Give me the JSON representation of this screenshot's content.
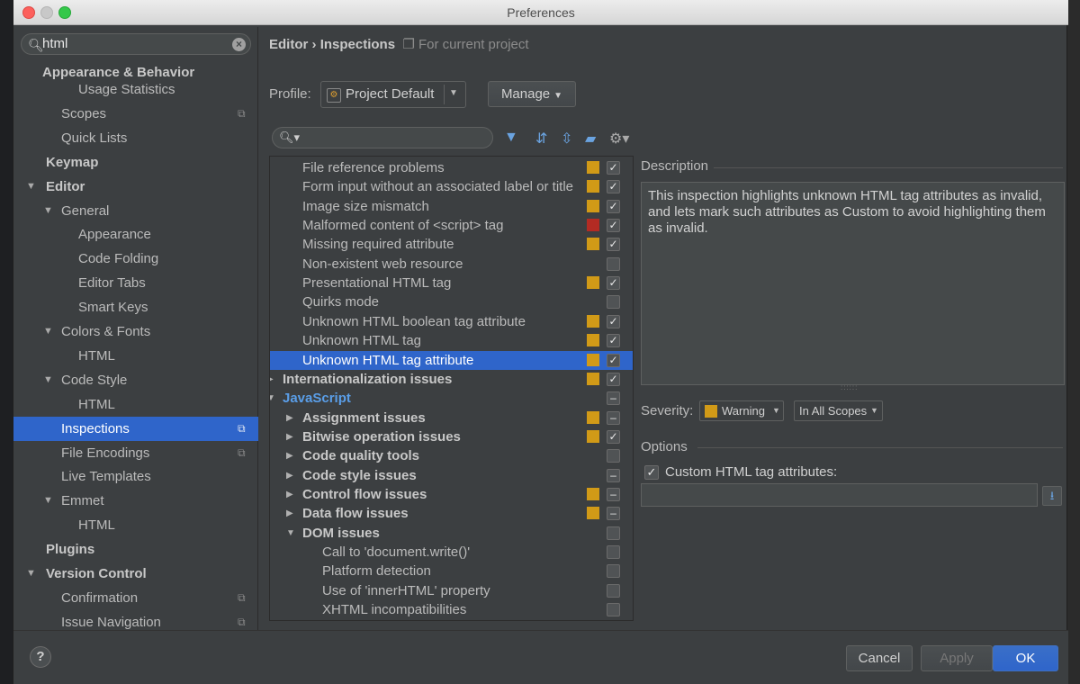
{
  "window": {
    "title": "Preferences"
  },
  "sidebar": {
    "search_value": "html",
    "items": [
      {
        "label": "Appearance & Behavior",
        "level": 0,
        "bold": true
      },
      {
        "label": "Usage Statistics",
        "level": 2
      },
      {
        "label": "Scopes",
        "level": 1,
        "project_icon": true
      },
      {
        "label": "Quick Lists",
        "level": 1
      },
      {
        "label": "Keymap",
        "level": 0,
        "bold": true
      },
      {
        "label": "Editor",
        "level": 0,
        "bold": true,
        "expanded": true
      },
      {
        "label": "General",
        "level": 1,
        "expanded": true
      },
      {
        "label": "Appearance",
        "level": 2
      },
      {
        "label": "Code Folding",
        "level": 2
      },
      {
        "label": "Editor Tabs",
        "level": 2
      },
      {
        "label": "Smart Keys",
        "level": 2
      },
      {
        "label": "Colors & Fonts",
        "level": 1,
        "expanded": true
      },
      {
        "label": "HTML",
        "level": 2
      },
      {
        "label": "Code Style",
        "level": 1,
        "expanded": true
      },
      {
        "label": "HTML",
        "level": 2
      },
      {
        "label": "Inspections",
        "level": 1,
        "selected": true,
        "project_icon": true
      },
      {
        "label": "File Encodings",
        "level": 1,
        "project_icon": true
      },
      {
        "label": "Live Templates",
        "level": 1
      },
      {
        "label": "Emmet",
        "level": 1,
        "expanded": true
      },
      {
        "label": "HTML",
        "level": 2
      },
      {
        "label": "Plugins",
        "level": 0,
        "bold": true
      },
      {
        "label": "Version Control",
        "level": 0,
        "bold": true,
        "expanded": true
      },
      {
        "label": "Confirmation",
        "level": 1,
        "project_icon": true
      },
      {
        "label": "Issue Navigation",
        "level": 1,
        "project_icon": true
      }
    ]
  },
  "breadcrumb": {
    "section": "Editor",
    "separator": "›",
    "page": "Inspections",
    "scope_note": "For current project"
  },
  "profile": {
    "label": "Profile:",
    "value": "Project Default",
    "manage_label": "Manage"
  },
  "inspections": [
    {
      "label": "File reference problems",
      "level": 2,
      "severity": "warning",
      "state": "checked"
    },
    {
      "label": "Form input without an associated label or title",
      "level": 2,
      "severity": "warning",
      "state": "checked"
    },
    {
      "label": "Image size mismatch",
      "level": 2,
      "severity": "warning",
      "state": "checked"
    },
    {
      "label": "Malformed content of <script> tag",
      "level": 2,
      "severity": "error",
      "state": "checked"
    },
    {
      "label": "Missing required attribute",
      "level": 2,
      "severity": "warning",
      "state": "checked"
    },
    {
      "label": "Non-existent web resource",
      "level": 2,
      "severity": "none",
      "state": "unchecked"
    },
    {
      "label": "Presentational HTML tag",
      "level": 2,
      "severity": "warning",
      "state": "checked"
    },
    {
      "label": "Quirks mode",
      "level": 2,
      "severity": "none",
      "state": "unchecked"
    },
    {
      "label": "Unknown HTML boolean tag attribute",
      "level": 2,
      "severity": "warning",
      "state": "checked"
    },
    {
      "label": "Unknown HTML tag",
      "level": 2,
      "severity": "warning",
      "state": "checked"
    },
    {
      "label": "Unknown HTML tag attribute",
      "level": 2,
      "severity": "warning",
      "state": "checked",
      "selected": true
    },
    {
      "label": "Internationalization issues",
      "level": 1,
      "group": true,
      "collapsed": true,
      "severity": "warning",
      "state": "checked"
    },
    {
      "label": "JavaScript",
      "level": 1,
      "group": true,
      "expanded": true,
      "link": true,
      "severity": "none",
      "state": "mixed"
    },
    {
      "label": "Assignment issues",
      "level": 2,
      "group": true,
      "collapsed": true,
      "severity": "warning",
      "state": "mixed"
    },
    {
      "label": "Bitwise operation issues",
      "level": 2,
      "group": true,
      "collapsed": true,
      "severity": "warning",
      "state": "checked"
    },
    {
      "label": "Code quality tools",
      "level": 2,
      "group": true,
      "collapsed": true,
      "severity": "none",
      "state": "unchecked"
    },
    {
      "label": "Code style issues",
      "level": 2,
      "group": true,
      "collapsed": true,
      "severity": "none",
      "state": "mixed"
    },
    {
      "label": "Control flow issues",
      "level": 2,
      "group": true,
      "collapsed": true,
      "severity": "warning",
      "state": "mixed"
    },
    {
      "label": "Data flow issues",
      "level": 2,
      "group": true,
      "collapsed": true,
      "severity": "warning",
      "state": "mixed"
    },
    {
      "label": "DOM issues",
      "level": 2,
      "group": true,
      "expanded": true,
      "severity": "none",
      "state": "unchecked"
    },
    {
      "label": "Call to 'document.write()'",
      "level": 3,
      "severity": "none",
      "state": "unchecked"
    },
    {
      "label": "Platform detection",
      "level": 3,
      "severity": "none",
      "state": "unchecked"
    },
    {
      "label": "Use of 'innerHTML' property",
      "level": 3,
      "severity": "none",
      "state": "unchecked"
    },
    {
      "label": "XHTML incompatibilities",
      "level": 3,
      "severity": "none",
      "state": "unchecked"
    }
  ],
  "description": {
    "heading": "Description",
    "text": "This inspection highlights unknown HTML tag attributes as invalid, and lets mark such attributes as Custom to avoid highlighting them as invalid."
  },
  "severity": {
    "label": "Severity:",
    "value": "Warning",
    "scope": "In All Scopes"
  },
  "options": {
    "heading": "Options",
    "checkbox_label": "Custom HTML tag attributes:",
    "checked": true,
    "field_value": ""
  },
  "buttons": {
    "cancel": "Cancel",
    "apply": "Apply",
    "ok": "OK",
    "help": "?"
  },
  "colors": {
    "selection": "#2f65ca",
    "warning": "#d19a17",
    "error": "#b32b23",
    "link": "#5a9ee8"
  }
}
